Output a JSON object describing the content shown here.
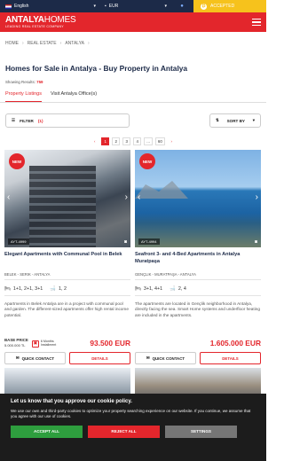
{
  "topbar": {
    "language": "English",
    "currency": "EUR",
    "accepted": "ACCEPTED"
  },
  "header": {
    "logo_main": "ANTALYA",
    "logo_accent": "HOMES",
    "logo_tagline": "LEADING REAL ESTATE COMPANY"
  },
  "breadcrumb": [
    "HOME",
    "REAL ESTATE",
    "ANTALYA"
  ],
  "page": {
    "title": "Homes for Sale in Antalya - Buy Property in Antalya",
    "showing_label": "Showing Results:",
    "showing_count": "759"
  },
  "tabs": [
    {
      "label": "Property Listings",
      "active": true
    },
    {
      "label": "Visit Antalya Office(s)",
      "active": false
    }
  ],
  "filters": {
    "filter_label": "FILTER",
    "filter_count": "(1)",
    "sort_label": "SORT BY"
  },
  "pagination": {
    "prev": "‹",
    "pages": [
      "1",
      "2",
      "3",
      "4",
      "...",
      "60"
    ],
    "next": "›",
    "current": "1"
  },
  "listings": [
    {
      "badge": "NEW",
      "code": "AYT-4999",
      "title": "Elegant Apartments with Communal Pool in Belek",
      "location": "BELEK - SERIK - ANTALYA",
      "rooms": "1+1, 2+1, 3+1",
      "baths": "1, 2",
      "description": "Apartments in Belek Antalya are in a project with communal pool and garden. The different-sized apartments offer high rental income potential.",
      "base_price_label": "BASE PRICE",
      "base_price_value": "5.000.000 TL",
      "installment": "6 Months Installment",
      "price": "93.500 EUR",
      "contact_label": "QUICK CONTACT",
      "details_label": "DETAILS"
    },
    {
      "badge": "NEW",
      "code": "AYT-4994",
      "title": "Seafront 3- and 4-Bed Apartments in Antalya Muratpaşa",
      "location": "GENÇLIK - MURATPAŞA - ANTALYA",
      "rooms": "3+1, 4+1",
      "baths": "2, 4",
      "description": "The apartments are located in Gençlik neighborhood in Antalya, directly facing the sea. Smart Home systems and underfloor heating are included in the apartments.",
      "price": "1.605.000 EUR",
      "contact_label": "QUICK CONTACT",
      "details_label": "DETAILS"
    }
  ],
  "cookie": {
    "title": "Let us know that you approve our cookie policy.",
    "text": "We use our own and third-party cookies to optimize your property searching experience on our website. If you continue, we assume that you agree with our use of cookies.",
    "accept": "ACCEPT ALL",
    "reject": "REJECT ALL",
    "settings": "SETTINGS"
  },
  "colors": {
    "brand_red": "#e3262c",
    "navy": "#1c2a48",
    "accept_green": "#2e9e3e",
    "accent_yellow": "#f6c21c"
  }
}
